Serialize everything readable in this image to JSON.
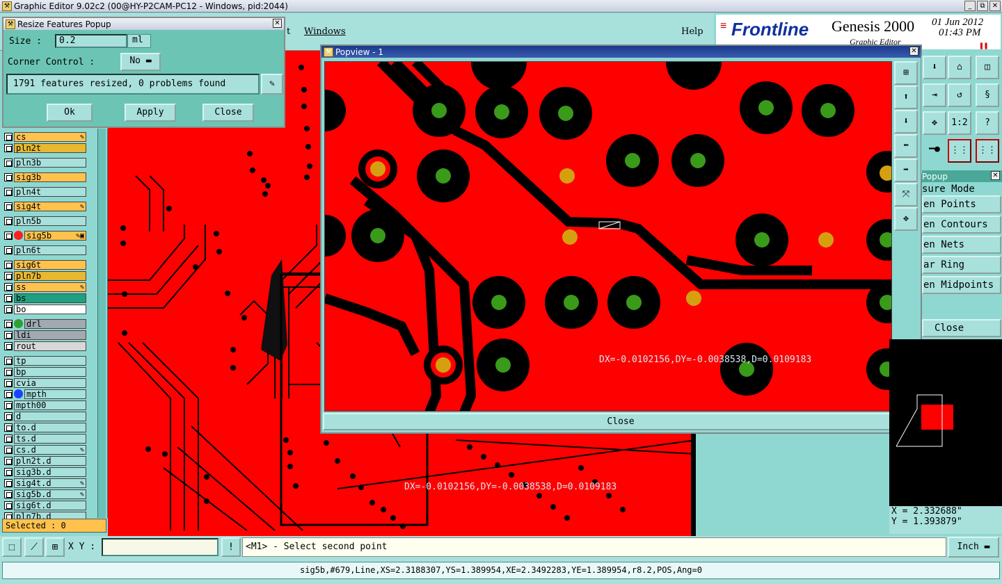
{
  "window": {
    "title": "Graphic Editor 9.02c2 (00@HY-P2CAM-PC12 - Windows, pid:2044)",
    "min": "_",
    "max": "⧉",
    "close": "✕"
  },
  "menu": {
    "item_t": "t",
    "windows": "Windows",
    "help": "Help"
  },
  "brand": {
    "logo": "Frontline",
    "product": "Genesis 2000",
    "subtitle": "Graphic Editor",
    "date": "01 Jun 2012",
    "time": "01:43 PM"
  },
  "resize_popup": {
    "title": "Resize Features Popup",
    "size_label": "Size :",
    "size_value": "0.2",
    "size_unit": "ml",
    "corner_label": "Corner Control :",
    "corner_value": "No",
    "result": "1791 features resized, 0 problems found",
    "ok": "Ok",
    "apply": "Apply",
    "close": "Close"
  },
  "layers": [
    {
      "name": "cs",
      "color": "#ffc24d",
      "mark": "✎",
      "dot": ""
    },
    {
      "name": "pln2t",
      "color": "#e8b830",
      "mark": "",
      "dot": ""
    },
    {
      "name": "pln3b",
      "color": "#a8e0dc",
      "mark": "",
      "dot": ""
    },
    {
      "name": "sig3b",
      "color": "#ffc24d",
      "mark": "",
      "dot": ""
    },
    {
      "name": "pln4t",
      "color": "#a8e0dc",
      "mark": "",
      "dot": ""
    },
    {
      "name": "sig4t",
      "color": "#ffc24d",
      "mark": "✎",
      "dot": ""
    },
    {
      "name": "pln5b",
      "color": "#a8e0dc",
      "mark": "",
      "dot": ""
    },
    {
      "name": "sig5b",
      "color": "#ffc24d",
      "mark": "✎▣",
      "dot": "#ff2020"
    },
    {
      "name": "pln6t",
      "color": "#a8e0dc",
      "mark": "",
      "dot": ""
    },
    {
      "name": "sig6t",
      "color": "#ffc24d",
      "mark": "",
      "dot": ""
    },
    {
      "name": "pln7b",
      "color": "#e8b830",
      "mark": "",
      "dot": ""
    },
    {
      "name": "ss",
      "color": "#ffc24d",
      "mark": "✎",
      "dot": ""
    },
    {
      "name": "bs",
      "color": "#20a080",
      "mark": "",
      "dot": ""
    },
    {
      "name": "bo",
      "color": "#ffffff",
      "mark": "",
      "dot": ""
    },
    {
      "name": "drl",
      "color": "#a0aab0",
      "mark": "",
      "dot": "#30a030"
    },
    {
      "name": "ldi",
      "color": "#a0aab0",
      "mark": "",
      "dot": ""
    },
    {
      "name": "rout",
      "color": "#d8d8d8",
      "mark": "",
      "dot": ""
    },
    {
      "name": "tp",
      "color": "#a8e0dc",
      "mark": "",
      "dot": ""
    },
    {
      "name": "bp",
      "color": "#a8e0dc",
      "mark": "",
      "dot": ""
    },
    {
      "name": "cvia",
      "color": "#a8e0dc",
      "mark": "",
      "dot": ""
    },
    {
      "name": "mpth",
      "color": "#a8e0dc",
      "mark": "",
      "dot": "#2040ff"
    },
    {
      "name": "mpth00",
      "color": "#a8e0dc",
      "mark": "",
      "dot": ""
    },
    {
      "name": "d",
      "color": "#a8e0dc",
      "mark": "",
      "dot": ""
    },
    {
      "name": "to.d",
      "color": "#a8e0dc",
      "mark": "",
      "dot": ""
    },
    {
      "name": "ts.d",
      "color": "#a8e0dc",
      "mark": "",
      "dot": ""
    },
    {
      "name": "cs.d",
      "color": "#a8e0dc",
      "mark": "✎",
      "dot": ""
    },
    {
      "name": "pln2t.d",
      "color": "#a8e0dc",
      "mark": "",
      "dot": ""
    },
    {
      "name": "sig3b.d",
      "color": "#a8e0dc",
      "mark": "",
      "dot": ""
    },
    {
      "name": "sig4t.d",
      "color": "#a8e0dc",
      "mark": "✎",
      "dot": ""
    },
    {
      "name": "sig5b.d",
      "color": "#a8e0dc",
      "mark": "✎",
      "dot": ""
    },
    {
      "name": "sig6t.d",
      "color": "#a8e0dc",
      "mark": "",
      "dot": ""
    },
    {
      "name": "pln7b.d",
      "color": "#a8e0dc",
      "mark": "",
      "dot": ""
    }
  ],
  "selected": "Selected : 0",
  "popview": {
    "title": "Popview - 1",
    "measure_text": "DX=-0.0102156,DY=-0.0038538,D=0.0109183",
    "close": "Close"
  },
  "main_measure_text": "DX=-0.0102156,DY=-0.0038538,D=0.0109183",
  "measure_popup": {
    "title": "Popup",
    "mode": "sure Mode",
    "items": [
      "en Points",
      "en Contours",
      "en Nets",
      "ar Ring",
      "en Midpoints"
    ],
    "close": "Close"
  },
  "tools_right": {
    "scale": "1:2",
    "help": "?"
  },
  "coords": {
    "x": "X = 2.332688\"",
    "y": "Y = 1.393879\""
  },
  "xy_label": "X Y :",
  "xy_value": "",
  "prompt": "<M1> - Select second point",
  "units": "Inch",
  "status": "sig5b,#679,Line,XS=2.3188307,YS=1.389954,XE=2.3492283,YE=1.389954,r8.2,POS,Ang=0"
}
